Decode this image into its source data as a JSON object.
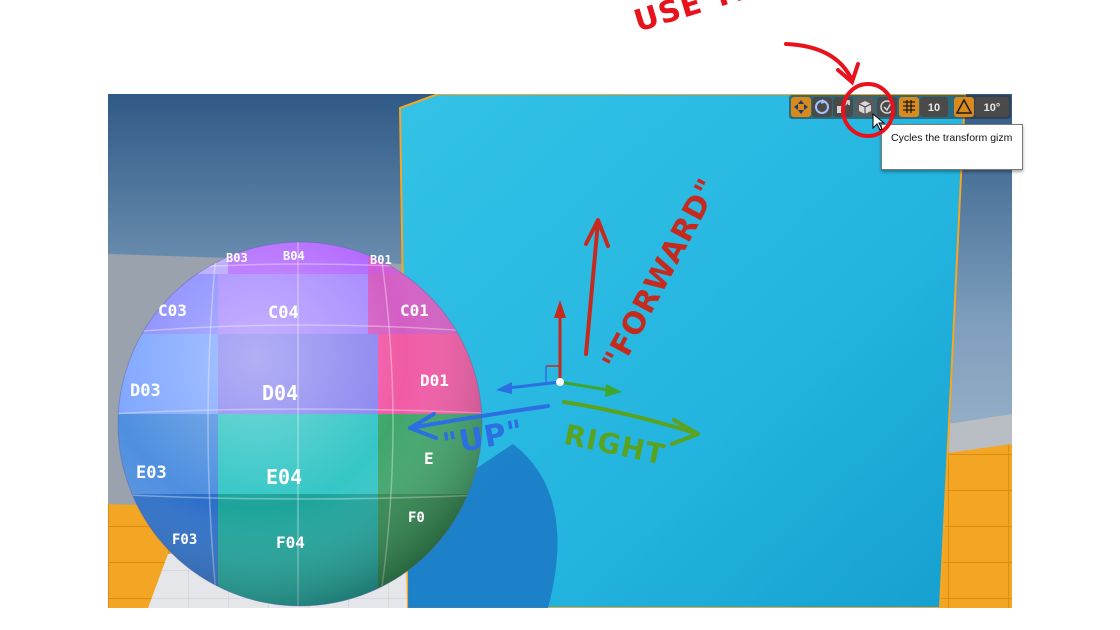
{
  "annotations": {
    "use_this": "USE THIS!",
    "forward": "\"FORWARD\"",
    "up": "\"UP\"",
    "right": "RIGHT"
  },
  "toolbar": {
    "grid_snap_value": "10",
    "rotation_snap_value": "10°",
    "tooltip": "Cycles the transform gizm",
    "icons": [
      "translate-icon",
      "rotate-icon",
      "scale-icon",
      "coordinate-system-icon",
      "surface-snapping-icon",
      "grid-snap-icon",
      "rotation-snap-icon"
    ]
  },
  "sphere_labels": {
    "b03": "B03",
    "b04": "B04",
    "b01": "B01",
    "c03": "C03",
    "c04": "C04",
    "c01": "C01",
    "d03": "D03",
    "d04": "D04",
    "d01": "D01",
    "e03": "E03",
    "e04": "E04",
    "e01": "E",
    "f03": "F03",
    "f04": "F04",
    "f01": "F0"
  },
  "colors": {
    "annotation_red": "#e8121c",
    "forward_red": "#c62a1f",
    "up_blue": "#2b6fe0",
    "right_green": "#5aa321",
    "wall_cyan": "#2ab7e0",
    "floor_orange": "#f2a623",
    "toolbar_orange": "#d98a1a"
  }
}
